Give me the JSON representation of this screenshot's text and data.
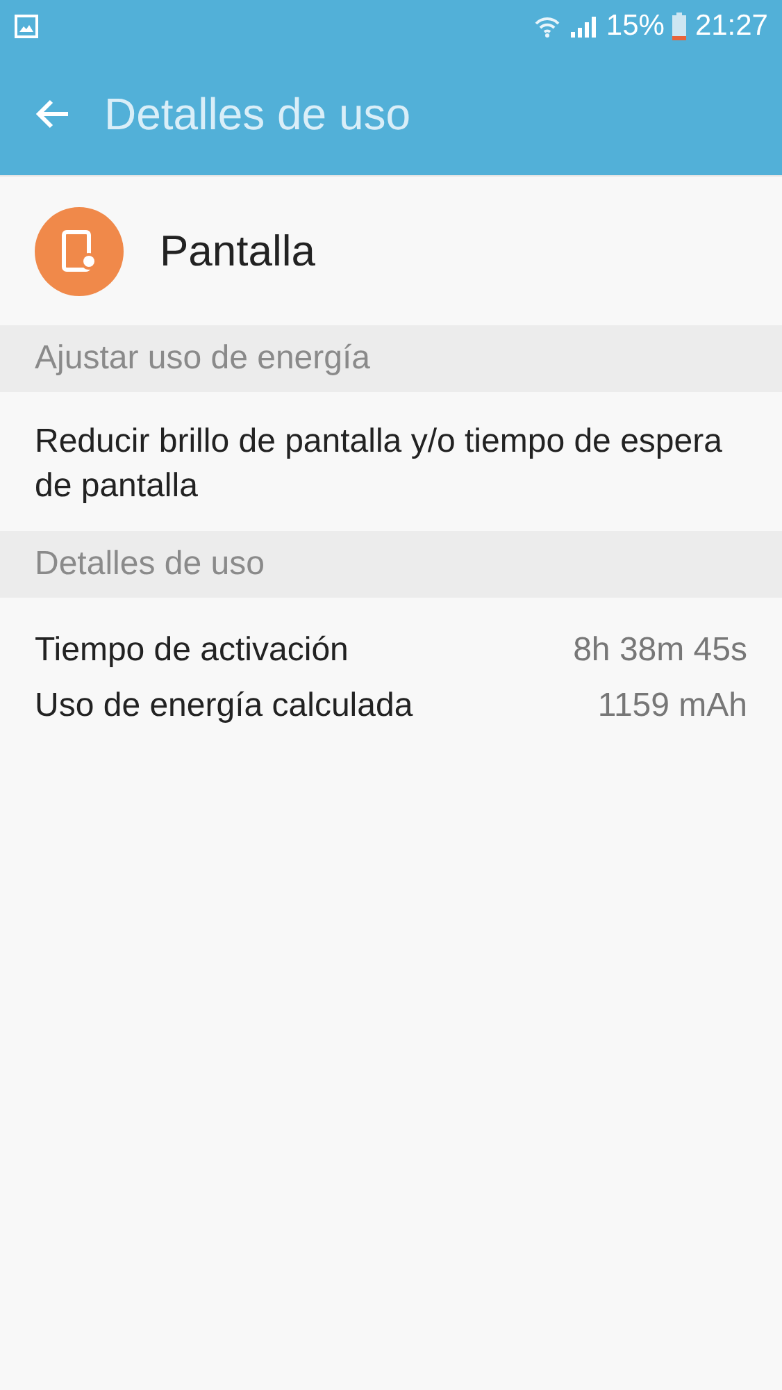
{
  "status_bar": {
    "battery_text": "15%",
    "time": "21:27"
  },
  "app_bar": {
    "title": "Detalles de uso"
  },
  "header": {
    "title": "Pantalla"
  },
  "sections": [
    {
      "title": "Ajustar uso de energía",
      "kind": "text",
      "text": "Reducir brillo de pantalla y/o tiempo de espera de pantalla"
    },
    {
      "title": "Detalles de uso",
      "kind": "rows",
      "rows": [
        {
          "label": "Tiempo de activación",
          "value": "8h 38m 45s"
        },
        {
          "label": "Uso de energía calculada",
          "value": "1159 mAh"
        }
      ]
    }
  ]
}
